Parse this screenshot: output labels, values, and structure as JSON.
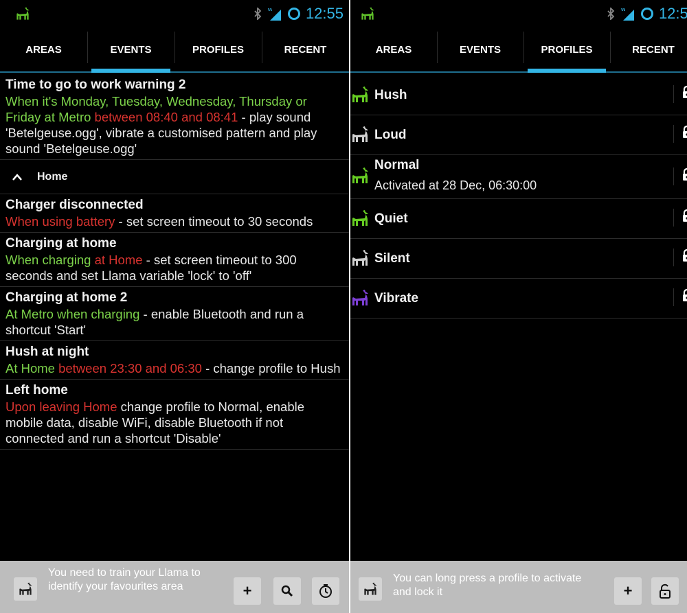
{
  "status": {
    "time": "12:55"
  },
  "left": {
    "tabs": [
      "AREAS",
      "EVENTS",
      "PROFILES",
      "RECENT"
    ],
    "active_tab": "EVENTS",
    "events": [
      {
        "title": "Time to go to work warning 2",
        "parts": [
          {
            "c": "g",
            "t": "When it's Monday, Tuesday, Wednesday, Thursday or Friday at Metro"
          },
          {
            "c": "r",
            "t": " between 08:40 and 08:41"
          },
          {
            "c": "w",
            "t": " - play sound 'Betelgeuse.ogg', vibrate a customised pattern and play sound 'Betelgeuse.ogg'"
          }
        ]
      }
    ],
    "group": {
      "label": "Home"
    },
    "group_events": [
      {
        "title": "Charger disconnected",
        "parts": [
          {
            "c": "r",
            "t": "When using battery"
          },
          {
            "c": "w",
            "t": " - set screen timeout to 30 seconds"
          }
        ]
      },
      {
        "title": "Charging at home",
        "parts": [
          {
            "c": "g",
            "t": "When charging "
          },
          {
            "c": "r",
            "t": "at Home"
          },
          {
            "c": "w",
            "t": " - set screen timeout to 300 seconds and set Llama variable 'lock' to 'off'"
          }
        ]
      },
      {
        "title": "Charging at home 2",
        "parts": [
          {
            "c": "g",
            "t": "At Metro when charging"
          },
          {
            "c": "w",
            "t": " - enable Bluetooth and run a shortcut 'Start'"
          }
        ]
      },
      {
        "title": "Hush at night",
        "parts": [
          {
            "c": "g",
            "t": "At Home"
          },
          {
            "c": "r",
            "t": " between 23:30 and 06:30"
          },
          {
            "c": "w",
            "t": " - change profile to Hush"
          }
        ]
      },
      {
        "title": "Left home",
        "parts": [
          {
            "c": "r",
            "t": "Upon leaving Home"
          },
          {
            "c": "w",
            "t": " change profile to Normal, enable mobile data, disable WiFi, disable Bluetooth if not connected and run a shortcut 'Disable'"
          }
        ]
      }
    ],
    "hint": "You need to train your Llama to identify your favourites area",
    "buttons": {
      "add": "+"
    }
  },
  "right": {
    "tabs": [
      "AREAS",
      "EVENTS",
      "PROFILES",
      "RECENT"
    ],
    "active_tab": "PROFILES",
    "profiles": [
      {
        "name": "Hush",
        "color": "#66cc22",
        "sub": ""
      },
      {
        "name": "Loud",
        "color": "#cfcfcf",
        "sub": ""
      },
      {
        "name": "Normal",
        "color": "#66cc22",
        "sub": "Activated at 28 Dec, 06:30:00"
      },
      {
        "name": "Quiet",
        "color": "#66cc22",
        "sub": ""
      },
      {
        "name": "Silent",
        "color": "#cfcfcf",
        "sub": ""
      },
      {
        "name": "Vibrate",
        "color": "#7d3fd6",
        "sub": ""
      }
    ],
    "hint": "You can long press a profile to activate and lock it",
    "buttons": {
      "add": "+"
    }
  },
  "colors": {
    "accent": "#33b5e5",
    "green": "#7cd24a",
    "red": "#d8332f",
    "purple": "#7d3fd6"
  }
}
